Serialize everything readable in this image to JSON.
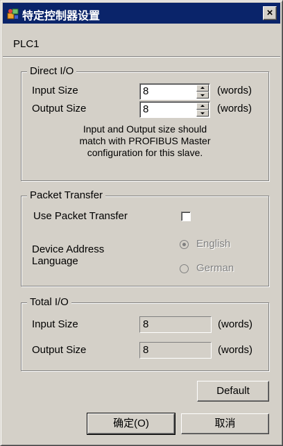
{
  "window": {
    "title": "特定控制器设置",
    "close_glyph": "×"
  },
  "header": {
    "plc_label": "PLC1"
  },
  "direct_io": {
    "title": "Direct I/O",
    "input_size_label": "Input Size",
    "input_size_value": "8",
    "input_size_unit": "(words)",
    "output_size_label": "Output Size",
    "output_size_value": "8",
    "output_size_unit": "(words)",
    "note_line1": "Input and Output size should",
    "note_line2": "match with PROFIBUS Master",
    "note_line3": "configuration for this slave."
  },
  "packet_transfer": {
    "title": "Packet Transfer",
    "use_label": "Use Packet Transfer",
    "use_checked": false,
    "language_label_line1": "Device Address",
    "language_label_line2": "Language",
    "option_english": "English",
    "option_german": "German",
    "selected": "English"
  },
  "total_io": {
    "title": "Total I/O",
    "input_size_label": "Input Size",
    "input_size_value": "8",
    "input_size_unit": "(words)",
    "output_size_label": "Output Size",
    "output_size_value": "8",
    "output_size_unit": "(words)"
  },
  "buttons": {
    "default": "Default",
    "ok": "确定(O)",
    "cancel": "取消"
  },
  "colors": {
    "title_bar": "#0a246a",
    "face": "#d4d0c8",
    "disabled_text": "#808080"
  },
  "icons": {
    "app": "plc-settings-icon",
    "close": "close-icon"
  }
}
